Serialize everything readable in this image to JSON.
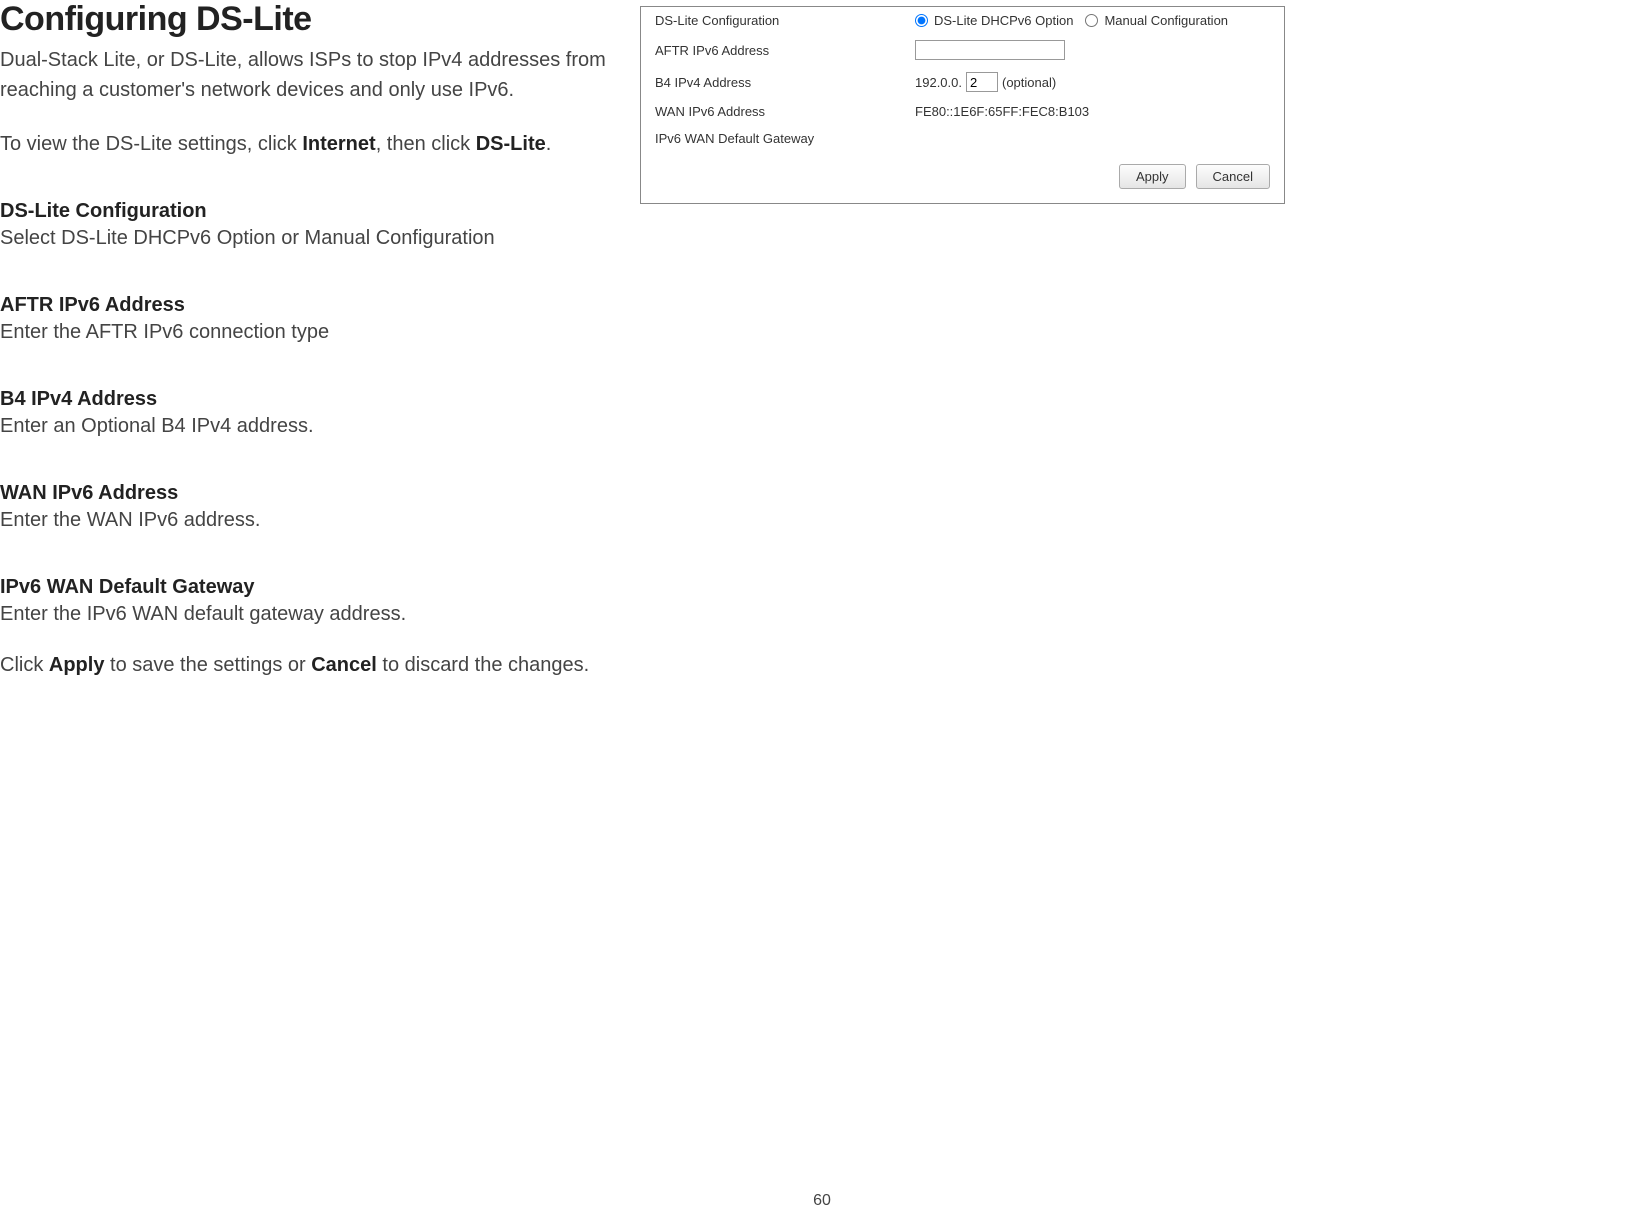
{
  "doc": {
    "title": "Configuring DS-Lite",
    "intro": "Dual-Stack Lite, or DS-Lite, allows ISPs to stop IPv4 addresses from reaching a customer's network devices and only use IPv6.",
    "nav_prefix": "To view the DS-Lite settings, click ",
    "nav_link1": "Internet",
    "nav_mid": ", then click ",
    "nav_link2": "DS-Lite",
    "nav_suffix": ".",
    "sections": [
      {
        "title": "DS-Lite Configuration",
        "desc": "Select DS-Lite DHCPv6 Option or Manual Configuration"
      },
      {
        "title": "AFTR IPv6 Address",
        "desc": "Enter the AFTR IPv6 connection type"
      },
      {
        "title": "B4 IPv4 Address",
        "desc": "Enter an Optional B4 IPv4 address."
      },
      {
        "title": "WAN IPv6 Address",
        "desc": "Enter the WAN IPv6 address."
      },
      {
        "title": "IPv6 WAN Default Gateway",
        "desc": "Enter the IPv6 WAN default gateway address."
      }
    ],
    "footer_prefix": "Click ",
    "footer_apply": "Apply",
    "footer_mid": " to save the settings or ",
    "footer_cancel": "Cancel",
    "footer_suffix": " to discard the changes.",
    "page_number": "60"
  },
  "panel": {
    "rows": {
      "ds_lite_config": {
        "label": "DS-Lite Configuration",
        "option1": "DS-Lite DHCPv6 Option",
        "option2": "Manual Configuration"
      },
      "aftr": {
        "label": "AFTR IPv6 Address",
        "value": ""
      },
      "b4": {
        "label": "B4 IPv4 Address",
        "prefix": "192.0.0.",
        "value": "2",
        "suffix": "(optional)"
      },
      "wan": {
        "label": "WAN IPv6 Address",
        "value": "FE80::1E6F:65FF:FEC8:B103"
      },
      "gateway": {
        "label": "IPv6 WAN Default Gateway",
        "value": ""
      }
    },
    "buttons": {
      "apply": "Apply",
      "cancel": "Cancel"
    }
  }
}
